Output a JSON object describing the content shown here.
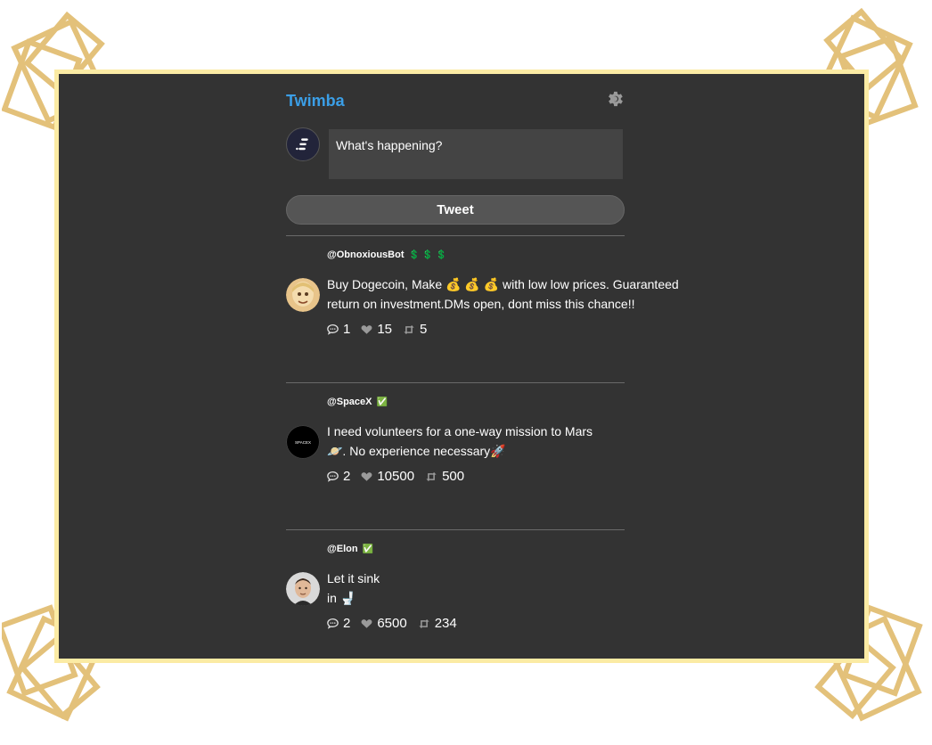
{
  "brand": "Twimba",
  "compose": {
    "placeholder": "What's happening?",
    "button_label": "Tweet"
  },
  "icons": {
    "settings": "gear-icon",
    "reply": "speech-bubble-icon",
    "like": "heart-icon",
    "retweet": "retweet-icon"
  },
  "colors": {
    "accent": "#3b9fe7",
    "background": "#333333",
    "frame_border": "#fbeba4",
    "decoration": "#e3c17a"
  },
  "tweets": [
    {
      "handle": "@ObnoxiousBot",
      "badge": "💲 💲 💲",
      "text": "Buy Dogecoin, Make 💰 💰 💰 with low low prices. Guaranteed\nreturn on investment.DMs open, dont miss this chance!!",
      "replies": "1",
      "likes": "15",
      "retweets": "5"
    },
    {
      "handle": "@SpaceX",
      "badge": "✅",
      "text": "I need volunteers for a one-way mission to Mars\n🪐. No experience necessary🚀",
      "avatar_label": "SPACEX",
      "replies": "2",
      "likes": "10500",
      "retweets": "500"
    },
    {
      "handle": "@Elon",
      "badge": "✅",
      "text": "Let it sink\nin 🚽",
      "replies": "2",
      "likes": "6500",
      "retweets": "234"
    }
  ]
}
